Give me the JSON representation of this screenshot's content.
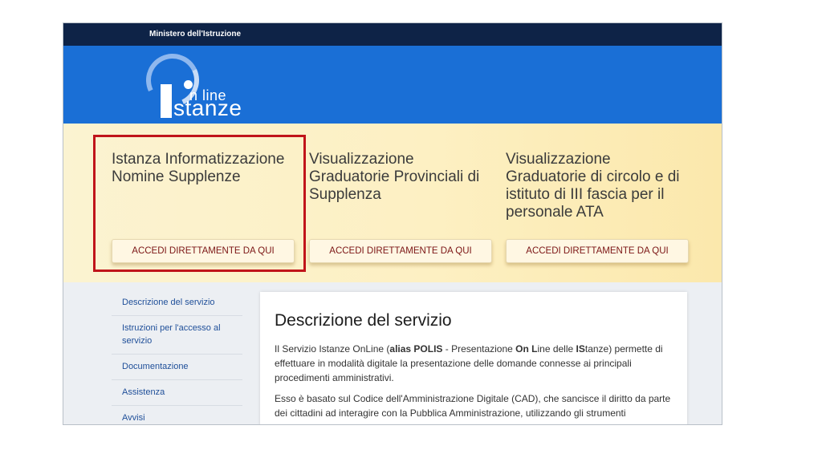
{
  "header": {
    "ministry": "Ministero dell'Istruzione",
    "logo_online": "n line",
    "logo_istanze": "stanze"
  },
  "services": [
    {
      "title": "Istanza Informatizzazione Nomine Supplenze",
      "button": "ACCEDI DIRETTAMENTE DA QUI"
    },
    {
      "title": "Visualizzazione Graduatorie Provinciali di Supplenza",
      "button": "ACCEDI DIRETTAMENTE DA QUI"
    },
    {
      "title": "Visualizzazione Graduatorie di circolo e di istituto di III fascia per il personale ATA",
      "button": "ACCEDI DIRETTAMENTE DA QUI"
    }
  ],
  "sidebar": {
    "items": [
      {
        "label": "Descrizione del servizio"
      },
      {
        "label": "Istruzioni per l'accesso al servizio"
      },
      {
        "label": "Documentazione"
      },
      {
        "label": "Assistenza"
      },
      {
        "label": "Avvisi"
      }
    ]
  },
  "main": {
    "title": "Descrizione del servizio",
    "p1_a": "Il Servizio Istanze OnLine (",
    "p1_b": "alias POLIS",
    "p1_c": " - Presentazione ",
    "p1_d": "On L",
    "p1_e": "ine delle ",
    "p1_f": "IS",
    "p1_g": "tanze) permette di effettuare in modalità digitale la presentazione delle domande connesse ai principali procedimenti amministrativi.",
    "p2": "Esso è basato sul Codice dell'Amministrazione Digitale (CAD), che sancisce il diritto da parte dei cittadini ad interagire con la Pubblica Amministrazione, utilizzando gli strumenti"
  },
  "colors": {
    "ministry_bar": "#0e2347",
    "hero_blue": "#1a6fd6",
    "highlight_red": "#c0141a",
    "button_text": "#7b1515"
  }
}
